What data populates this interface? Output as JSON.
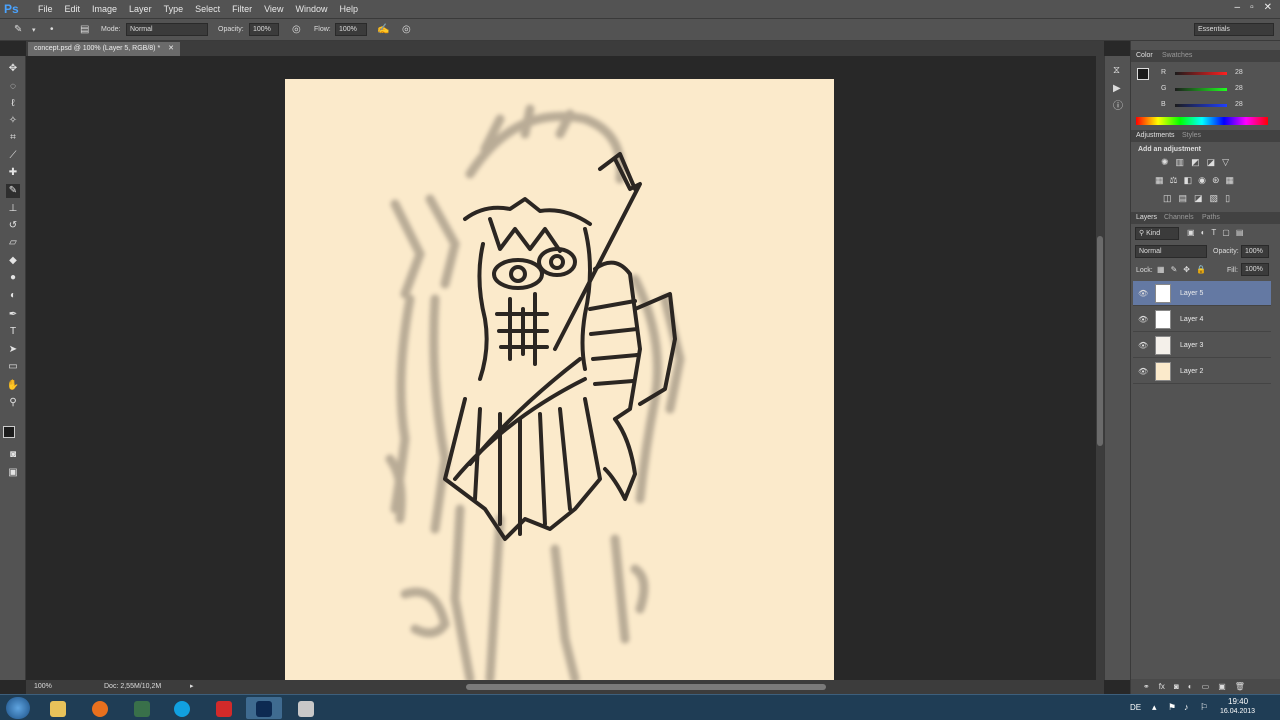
{
  "app": {
    "logo": "Ps"
  },
  "menu": [
    "File",
    "Edit",
    "Image",
    "Layer",
    "Type",
    "Select",
    "Filter",
    "View",
    "Window",
    "Help"
  ],
  "window_controls": {
    "minimize": "‒",
    "restore": "▫",
    "close": "✕"
  },
  "options": {
    "mode_label": "Mode:",
    "mode_value": "Normal",
    "opacity_label": "Opacity:",
    "opacity_value": "100%",
    "flow_label": "Flow:",
    "flow_value": "100%",
    "workspace": "Essentials"
  },
  "document_tab": "concept.psd @ 100% (Layer 5, RGB/8) *",
  "status": {
    "zoom": "100%",
    "doc_info": "Doc: 2,55M/10,2M"
  },
  "color_panel": {
    "tabs": [
      "Color",
      "Swatches"
    ],
    "channels": [
      {
        "label": "R",
        "value": "28"
      },
      {
        "label": "G",
        "value": "28"
      },
      {
        "label": "B",
        "value": "28"
      }
    ]
  },
  "adjustments_panel": {
    "tabs": [
      "Adjustments",
      "Styles"
    ],
    "heading": "Add an adjustment"
  },
  "layers_panel": {
    "tabs": [
      "Layers",
      "Channels",
      "Paths"
    ],
    "kind_label": "Kind",
    "blend_mode": "Normal",
    "opacity_label": "Opacity:",
    "opacity_value": "100%",
    "lock_label": "Lock:",
    "fill_label": "Fill:",
    "fill_value": "100%",
    "layers": [
      {
        "name": "Layer 5",
        "selected": true
      },
      {
        "name": "Layer 4",
        "selected": false
      },
      {
        "name": "Layer 3",
        "selected": false
      },
      {
        "name": "Layer 2",
        "selected": false
      }
    ]
  },
  "taskbar": {
    "lang": "DE",
    "time": "19:40",
    "date": "16.04.2013"
  },
  "colors": {
    "ui_gray": "#535353",
    "canvas_bg": "#282828",
    "paper": "#fbeacb",
    "selection": "#6479a3",
    "taskbar": "#1f3d55"
  }
}
